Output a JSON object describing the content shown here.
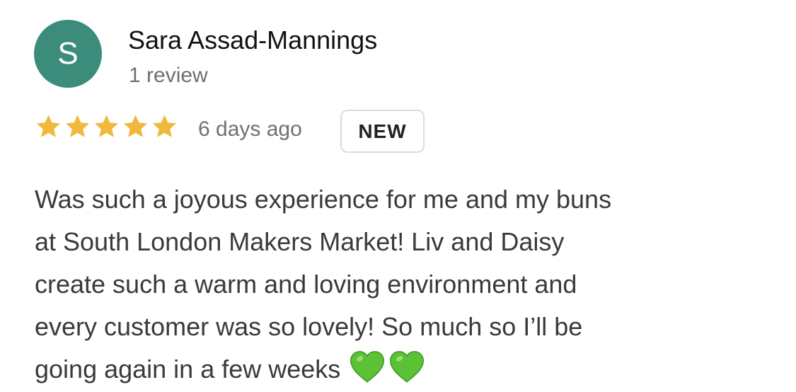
{
  "reviewer": {
    "avatar_letter": "S",
    "name": "Sara Assad-Mannings",
    "review_count": "1 review"
  },
  "rating": {
    "stars": 5,
    "max_stars": 5,
    "date": "6 days ago",
    "badge": "NEW"
  },
  "review": {
    "lines": [
      "Was such a joyous experience for me and my buns",
      "at South London Makers Market! Liv and Daisy",
      "create such a warm and loving environment and",
      "every customer was so lovely! So much so I’ll be",
      "going again in a few weeks"
    ],
    "emoji": [
      "green-heart-icon",
      "green-heart-icon"
    ]
  },
  "colors": {
    "avatar_bg": "#3b8c7b",
    "star": "#f0b93d",
    "heart": "#5bc236"
  }
}
